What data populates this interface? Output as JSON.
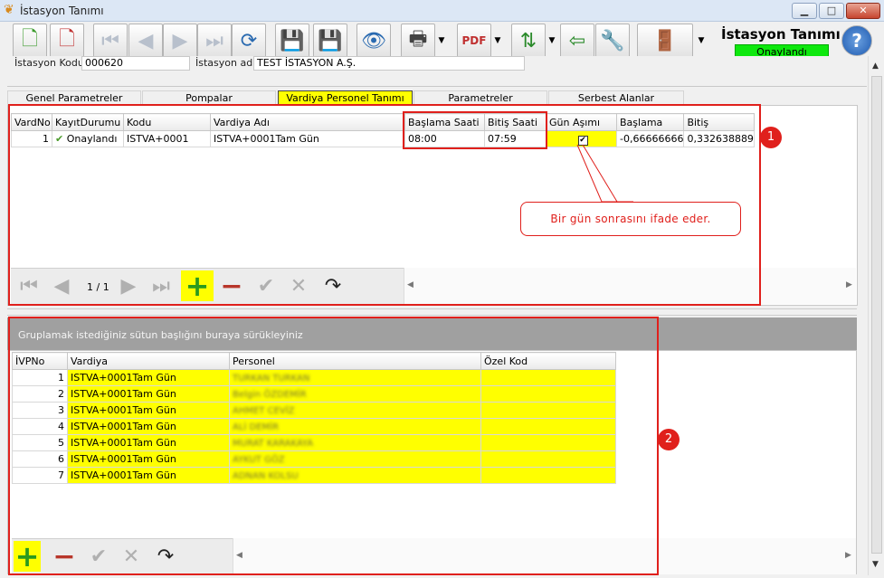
{
  "window": {
    "title": "İstasyon Tanımı",
    "min": "▁",
    "max": "□",
    "close": "✕"
  },
  "header": {
    "title": "İstasyon Tanımı",
    "status": "Onaylandı"
  },
  "fields": {
    "code_label": "İstasyon Kodu",
    "code_value": "000620",
    "name_label": "İstasyon adı",
    "name_value": "TEST İSTASYON A.Ş."
  },
  "tabs": [
    "Genel Parametreler",
    "Pompalar",
    "Vardiya Personel Tanımı",
    "Parametreler",
    "Serbest Alanlar"
  ],
  "shift_grid": {
    "columns": [
      "VardNo",
      "KayıtDurumu",
      "Kodu",
      "Vardiya Adı",
      "Başlama Saati",
      "Bitiş Saati",
      "Gün Aşımı",
      "Başlama",
      "Bitiş"
    ],
    "row": {
      "no": "1",
      "status_icon": "✔",
      "status": "Onaylandı",
      "code": "ISTVA+0001",
      "name": "ISTVA+0001Tam Gün",
      "start": "08:00",
      "end": "07:59",
      "overflow": "✔",
      "start_num": "-0,66666666",
      "end_num": "0,332638889"
    },
    "pager": "1 / 1"
  },
  "callout": "Bir gün sonrasını ifade eder.",
  "badge1": "1",
  "badge2": "2",
  "group_hint": "Gruplamak istediğiniz sütun başlığını buraya sürükleyiniz",
  "personnel_grid": {
    "columns": [
      "İVPNo",
      "Vardiya",
      "Personel",
      "Özel Kod"
    ],
    "rows": [
      {
        "no": "1",
        "shift": "ISTVA+0001Tam Gün",
        "person": "TURKAN TURKAN"
      },
      {
        "no": "2",
        "shift": "ISTVA+0001Tam Gün",
        "person": "Belgin ÖZDEMİR"
      },
      {
        "no": "3",
        "shift": "ISTVA+0001Tam Gün",
        "person": "AHMET CEVİZ"
      },
      {
        "no": "4",
        "shift": "ISTVA+0001Tam Gün",
        "person": "ALİ DEMİR"
      },
      {
        "no": "5",
        "shift": "ISTVA+0001Tam Gün",
        "person": "MURAT KARAKAYA"
      },
      {
        "no": "6",
        "shift": "ISTVA+0001Tam Gün",
        "person": "AYKUT GÖZ"
      },
      {
        "no": "7",
        "shift": "ISTVA+0001Tam Gün",
        "person": "ADNAN KOLSU"
      }
    ]
  }
}
